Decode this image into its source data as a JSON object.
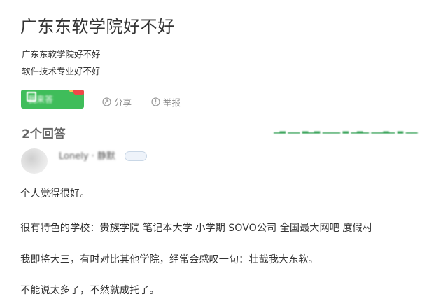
{
  "question": {
    "title": "广东东软学院好不好",
    "description_lines": [
      "广东东软学院好不好",
      "软件技术专业好不好"
    ]
  },
  "actions": {
    "answer_label": "我来答",
    "share_label": "分享",
    "report_label": "举报"
  },
  "answers_header": {
    "count_label": "2个回答"
  },
  "answer": {
    "author": "Lonely · 静默",
    "paragraphs": [
      "个人觉得很好。",
      "很有特色的学校：贵族学院 笔记本大学 小学期 SOVO公司 全国最大网吧 度假村",
      "我即将大三，有时对比其他学院，经常会感叹一句：壮哉我大东软。",
      "不能说太多了，不然就成托了。"
    ]
  },
  "colors": {
    "accent_green": "#3fbd5a",
    "badge_red": "#f04848",
    "muted_text": "#8a8a8a"
  },
  "icons": {
    "share": "share-icon",
    "report": "report-icon",
    "answer": "pen-icon"
  }
}
